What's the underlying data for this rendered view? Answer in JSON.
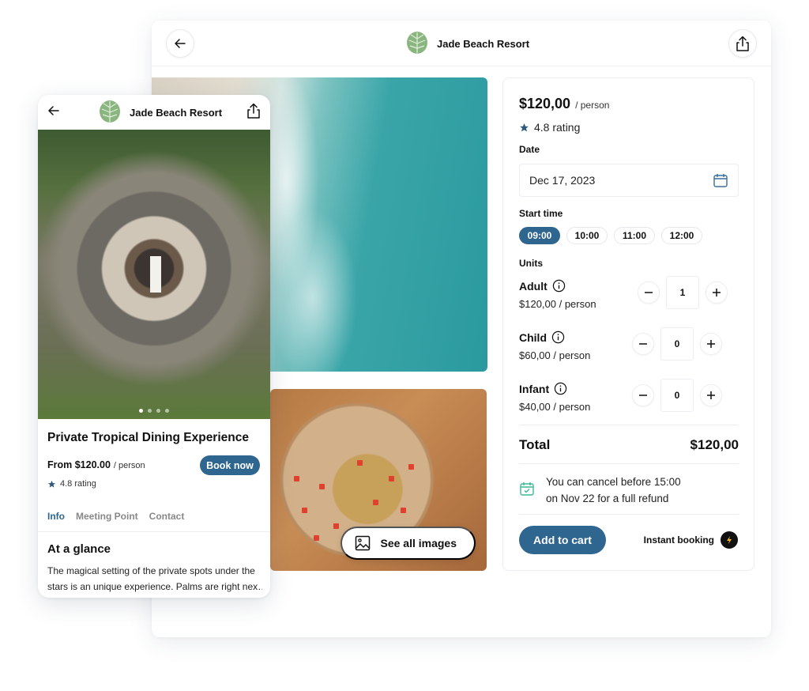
{
  "brand": {
    "name": "Jade Beach Resort",
    "logo_icon": "palm-leaf-logo"
  },
  "colors": {
    "primary": "#2f6690",
    "accent_green": "#3cb896",
    "text": "#111111",
    "border": "#eceef1"
  },
  "desktop": {
    "header": {
      "back_icon": "arrow-left-icon",
      "share_icon": "share-icon",
      "title": "Jade Beach Resort"
    },
    "gallery": {
      "see_all_label": "See all images",
      "see_all_icon": "image-icon"
    },
    "booking": {
      "price": "$120,00",
      "price_unit": "/ person",
      "rating": "4.8 rating",
      "date_label": "Date",
      "date_value": "Dec 17, 2023",
      "start_time_label": "Start time",
      "times": [
        {
          "label": "09:00",
          "selected": true
        },
        {
          "label": "10:00",
          "selected": false
        },
        {
          "label": "11:00",
          "selected": false
        },
        {
          "label": "12:00",
          "selected": false
        }
      ],
      "units_label": "Units",
      "units": [
        {
          "name": "Adult",
          "price": "$120,00 / person",
          "qty": "1"
        },
        {
          "name": "Child",
          "price": "$60,00 / person",
          "qty": "0"
        },
        {
          "name": "Infant",
          "price": "$40,00 / person",
          "qty": "0"
        }
      ],
      "total_label": "Total",
      "total_value": "$120,00",
      "cancel_line1": "You can cancel before 15:00",
      "cancel_line2": "on Nov 22 for a full refund",
      "add_to_cart": "Add to cart",
      "instant_booking": "Instant booking"
    }
  },
  "mobile": {
    "header": {
      "title": "Jade Beach Resort"
    },
    "carousel": {
      "total": 4,
      "active": 1
    },
    "title": "Private Tropical Dining Experience",
    "from_price": "From $120.00",
    "price_unit": "/ person",
    "book_now": "Book now",
    "rating": "4.8 rating",
    "tabs": [
      {
        "label": "Info",
        "active": true
      },
      {
        "label": "Meeting Point",
        "active": false
      },
      {
        "label": "Contact",
        "active": false
      }
    ],
    "section_title": "At a glance",
    "description_line1": "The magical setting of the private spots under the",
    "description_line2": "stars is an unique experience. Palms are right nex…"
  }
}
